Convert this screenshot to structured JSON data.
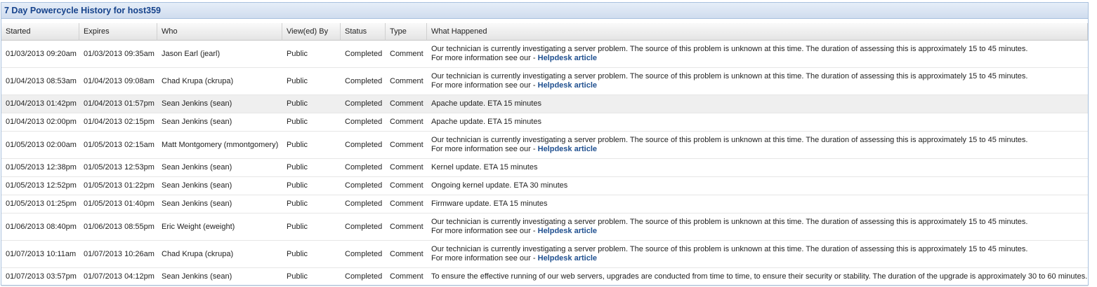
{
  "panel": {
    "title": "7 Day Powercycle History for host359"
  },
  "columns": [
    "Started",
    "Expires",
    "Who",
    "View(ed) By",
    "Status",
    "Type",
    "What Happened"
  ],
  "rows": [
    {
      "started": "01/03/2013 09:20am",
      "expires": "01/03/2013 09:35am",
      "who": "Jason Earl (jearl)",
      "viewed_by": "Public",
      "status": "Completed",
      "type": "Comment",
      "what": "Our technician is currently investigating a server problem. The source of this problem is unknown at this time. The duration of assessing this is approximately 15 to 45 minutes.",
      "more_prefix": "For more information see our - ",
      "link": "Helpdesk article"
    },
    {
      "started": "01/04/2013 08:53am",
      "expires": "01/04/2013 09:08am",
      "who": "Chad Krupa (ckrupa)",
      "viewed_by": "Public",
      "status": "Completed",
      "type": "Comment",
      "what": "Our technician is currently investigating a server problem. The source of this problem is unknown at this time. The duration of assessing this is approximately 15 to 45 minutes.",
      "more_prefix": "For more information see our - ",
      "link": "Helpdesk article"
    },
    {
      "started": "01/04/2013 01:42pm",
      "expires": "01/04/2013 01:57pm",
      "who": "Sean Jenkins (sean)",
      "viewed_by": "Public",
      "status": "Completed",
      "type": "Comment",
      "what": "Apache update. ETA 15 minutes"
    },
    {
      "started": "01/04/2013 02:00pm",
      "expires": "01/04/2013 02:15pm",
      "who": "Sean Jenkins (sean)",
      "viewed_by": "Public",
      "status": "Completed",
      "type": "Comment",
      "what": "Apache update. ETA 15 minutes"
    },
    {
      "started": "01/05/2013 02:00am",
      "expires": "01/05/2013 02:15am",
      "who": "Matt Montgomery (mmontgomery)",
      "viewed_by": "Public",
      "status": "Completed",
      "type": "Comment",
      "what": "Our technician is currently investigating a server problem. The source of this problem is unknown at this time. The duration of assessing this is approximately 15 to 45 minutes.",
      "more_prefix": "For more information see our - ",
      "link": "Helpdesk article"
    },
    {
      "started": "01/05/2013 12:38pm",
      "expires": "01/05/2013 12:53pm",
      "who": "Sean Jenkins (sean)",
      "viewed_by": "Public",
      "status": "Completed",
      "type": "Comment",
      "what": "Kernel update. ETA 15 minutes"
    },
    {
      "started": "01/05/2013 12:52pm",
      "expires": "01/05/2013 01:22pm",
      "who": "Sean Jenkins (sean)",
      "viewed_by": "Public",
      "status": "Completed",
      "type": "Comment",
      "what": "Ongoing kernel update. ETA 30 minutes"
    },
    {
      "started": "01/05/2013 01:25pm",
      "expires": "01/05/2013 01:40pm",
      "who": "Sean Jenkins (sean)",
      "viewed_by": "Public",
      "status": "Completed",
      "type": "Comment",
      "what": "Firmware update. ETA 15 minutes"
    },
    {
      "started": "01/06/2013 08:40pm",
      "expires": "01/06/2013 08:55pm",
      "who": "Eric Weight (eweight)",
      "viewed_by": "Public",
      "status": "Completed",
      "type": "Comment",
      "what": "Our technician is currently investigating a server problem. The source of this problem is unknown at this time. The duration of assessing this is approximately 15 to 45 minutes.",
      "more_prefix": "For more information see our - ",
      "link": "Helpdesk article"
    },
    {
      "started": "01/07/2013 10:11am",
      "expires": "01/07/2013 10:26am",
      "who": "Chad Krupa (ckrupa)",
      "viewed_by": "Public",
      "status": "Completed",
      "type": "Comment",
      "what": "Our technician is currently investigating a server problem. The source of this problem is unknown at this time. The duration of assessing this is approximately 15 to 45 minutes.",
      "more_prefix": "For more information see our - ",
      "link": "Helpdesk article"
    },
    {
      "started": "01/07/2013 03:57pm",
      "expires": "01/07/2013 04:12pm",
      "who": "Sean Jenkins (sean)",
      "viewed_by": "Public",
      "status": "Completed",
      "type": "Comment",
      "what": "To ensure the effective running of our web servers, upgrades are conducted from time to time, to ensure their security or stability. The duration of the upgrade is approximately 30 to 60 minutes."
    }
  ]
}
